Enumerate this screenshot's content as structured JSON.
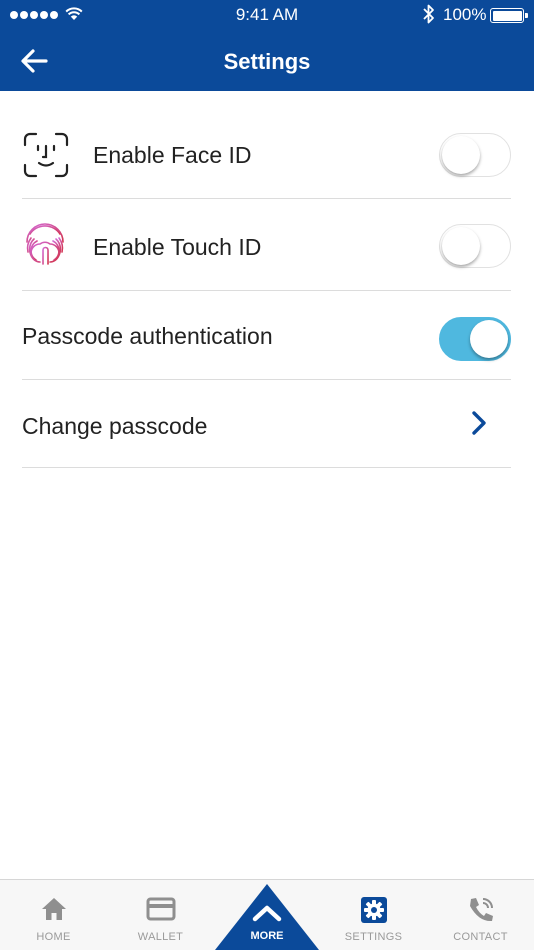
{
  "status_bar": {
    "time": "9:41 AM",
    "battery": "100%"
  },
  "header": {
    "title": "Settings"
  },
  "settings": [
    {
      "label": "Enable Face ID",
      "enabled": false
    },
    {
      "label": "Enable Touch ID",
      "enabled": false
    },
    {
      "label": "Passcode authentication",
      "enabled": true
    },
    {
      "label": "Change passcode"
    }
  ],
  "tabs": [
    {
      "label": "HOME",
      "icon": "home-icon"
    },
    {
      "label": "WALLET",
      "icon": "wallet-icon"
    },
    {
      "label": "MORE",
      "icon": "chevron-up-icon"
    },
    {
      "label": "SETTINGS",
      "icon": "gear-icon",
      "active": true
    },
    {
      "label": "CONTACT",
      "icon": "phone-icon"
    }
  ],
  "colors": {
    "primary": "#0b4a9a",
    "toggle_on": "#4fb8df",
    "tab_inactive": "#9a9a9a"
  }
}
